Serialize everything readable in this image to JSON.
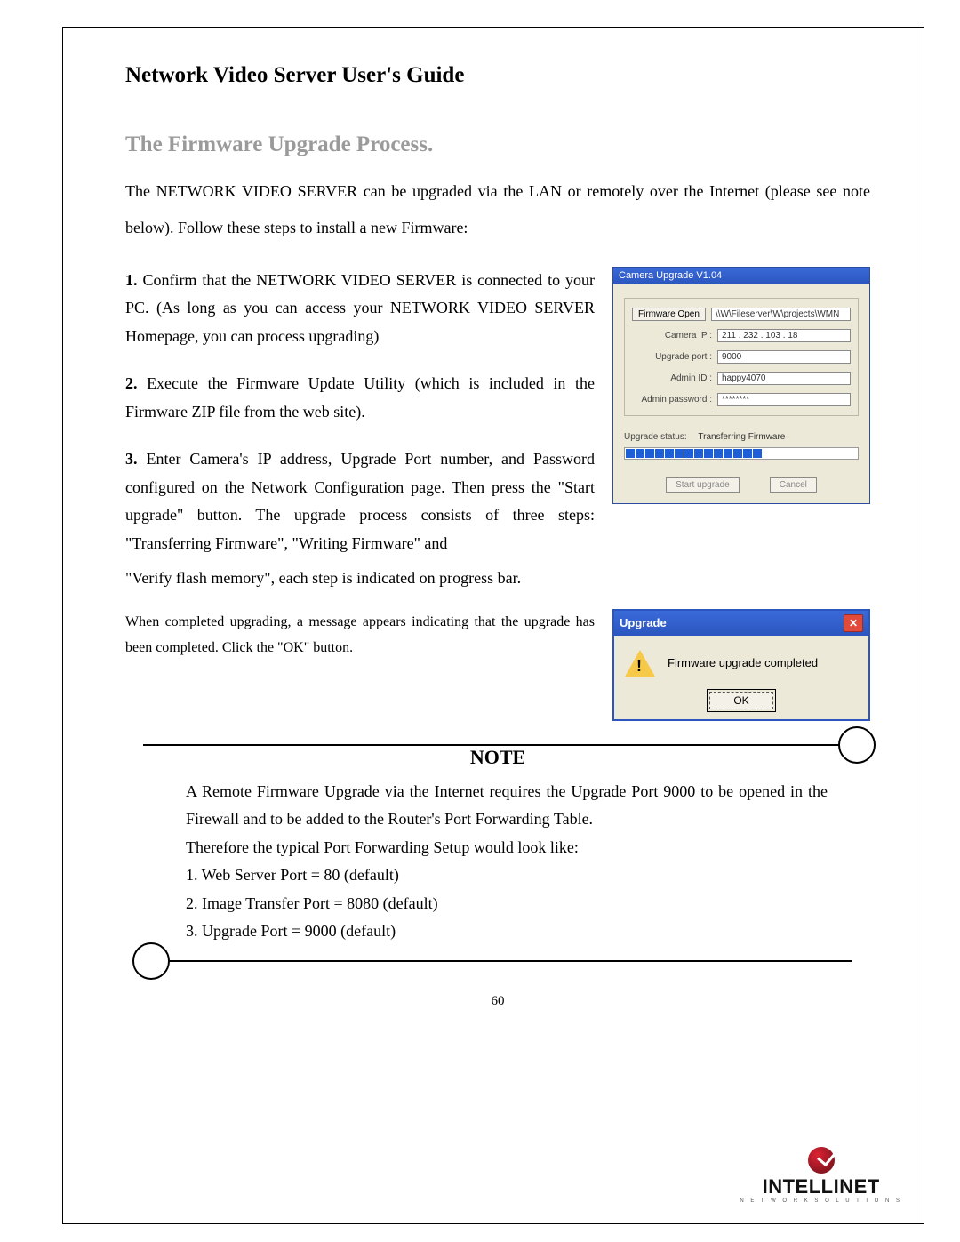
{
  "doc_title": "Network Video Server User's Guide",
  "section_title": "The Firmware Upgrade Process.",
  "intro": "The NETWORK VIDEO SERVER can be upgraded via the LAN or remotely over the Internet (please see note below). Follow these steps to install a new Firmware:",
  "steps": [
    {
      "num": "1.",
      "text": "Confirm that the NETWORK VIDEO SERVER is connected to your PC. (As long as you can access your NETWORK VIDEO SERVER Homepage, you can process upgrading)"
    },
    {
      "num": "2.",
      "text": "Execute the Firmware Update Utility (which is included in the Firmware ZIP file from the web site)."
    },
    {
      "num": "3.",
      "text": "Enter Camera's IP address, Upgrade Port number, and Password configured on the Network Configuration page. Then press the \"Start upgrade\" button. The upgrade process consists of three steps: \"Transferring Firmware\", \"Writing Firmware\" and"
    }
  ],
  "step3_cont": "\"Verify flash memory\", each step is indicated on progress bar.",
  "completed_text": "When completed upgrading, a message appears indicating that the upgrade has been completed. Click the \"OK\" button.",
  "win1": {
    "title": "Camera Upgrade V1.04",
    "firmware_open_btn": "Firmware Open",
    "firmware_path": "\\\\W\\Fileserver\\W\\projects\\WMN",
    "camera_ip_lbl": "Camera IP :",
    "camera_ip": "211  .  232  .  103  .   18",
    "upgrade_port_lbl": "Upgrade port :",
    "upgrade_port": "9000",
    "admin_id_lbl": "Admin ID :",
    "admin_id": "happy4070",
    "admin_pw_lbl": "Admin password :",
    "admin_pw": "********",
    "status_lbl": "Upgrade status:",
    "status_val": "Transferring Firmware",
    "start_btn": "Start upgrade",
    "cancel_btn": "Cancel",
    "progress_segments": 14
  },
  "win2": {
    "title": "Upgrade",
    "msg": "Firmware upgrade completed",
    "ok": "OK"
  },
  "note": {
    "title": "NOTE",
    "p1": "A Remote Firmware Upgrade via the Internet requires the Upgrade Port 9000 to be opened in the Firewall and to be added to the Router's Port Forwarding Table.",
    "p2": "Therefore the typical Port Forwarding Setup would look like:",
    "l1": "1. Web Server Port = 80 (default)",
    "l2": "2. Image Transfer Port = 8080 (default)",
    "l3": "3. Upgrade Port = 9000 (default)"
  },
  "page_number": "60",
  "brand": {
    "name": "INTELLINET",
    "tag": "N E T W O R K   S O L U T I O N S"
  }
}
